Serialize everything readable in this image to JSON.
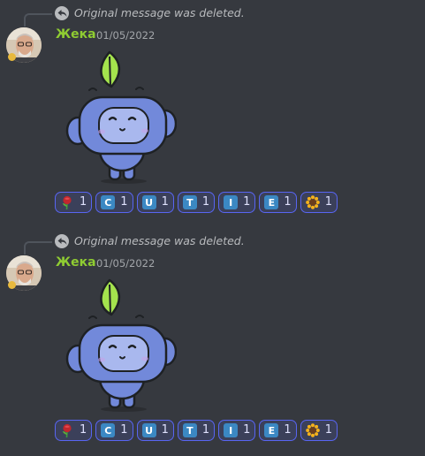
{
  "messages": [
    {
      "reply_text": "Original message was deleted.",
      "username": "Жека",
      "timestamp": "01/05/2022",
      "reactions": [
        {
          "emoji": "rose-icon",
          "count": "1"
        },
        {
          "emoji": "regional-indicator-c-icon",
          "letter": "C",
          "count": "1"
        },
        {
          "emoji": "regional-indicator-u-icon",
          "letter": "U",
          "count": "1"
        },
        {
          "emoji": "regional-indicator-t-icon",
          "letter": "T",
          "count": "1"
        },
        {
          "emoji": "regional-indicator-i-icon",
          "letter": "I",
          "count": "1"
        },
        {
          "emoji": "regional-indicator-e-icon",
          "letter": "E",
          "count": "1"
        },
        {
          "emoji": "sunflower-icon",
          "count": "1"
        }
      ]
    },
    {
      "reply_text": "Original message was deleted.",
      "username": "Жека",
      "timestamp": "01/05/2022",
      "reactions": [
        {
          "emoji": "rose-icon",
          "count": "1"
        },
        {
          "emoji": "regional-indicator-c-icon",
          "letter": "C",
          "count": "1"
        },
        {
          "emoji": "regional-indicator-u-icon",
          "letter": "U",
          "count": "1"
        },
        {
          "emoji": "regional-indicator-t-icon",
          "letter": "T",
          "count": "1"
        },
        {
          "emoji": "regional-indicator-i-icon",
          "letter": "I",
          "count": "1"
        },
        {
          "emoji": "regional-indicator-e-icon",
          "letter": "E",
          "count": "1"
        },
        {
          "emoji": "sunflower-icon",
          "count": "1"
        }
      ]
    }
  ],
  "colors": {
    "background": "#36393f",
    "username": "#8fcc32",
    "reaction_border": "#5865f2",
    "reaction_bg": "#3b405a",
    "regional_indicator": "#3b88c3",
    "wumpus": "#7289da",
    "leaf": "#a4e34d"
  },
  "sticker": "wumpus-with-leaf-sticker"
}
